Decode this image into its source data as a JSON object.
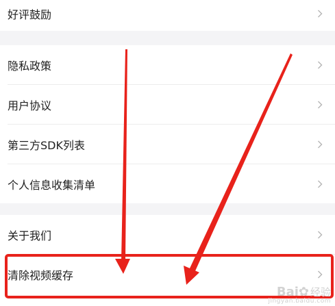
{
  "settings": {
    "items": [
      {
        "label": "好评鼓励"
      },
      {
        "label": "隐私政策"
      },
      {
        "label": "用户协议"
      },
      {
        "label": "第三方SDK列表"
      },
      {
        "label": "个人信息收集清单"
      },
      {
        "label": "关于我们"
      },
      {
        "label": "清除视频缓存"
      }
    ]
  },
  "annotation": {
    "arrow_color": "#e8221b",
    "highlight_color": "#e8221b"
  },
  "watermark": {
    "logo": "Bai",
    "logo_tail": "经验",
    "url": "jingyan.baidu.com"
  },
  "colors": {
    "background": "#f4f4f6",
    "row_background": "#ffffff",
    "text": "#1f1f1f",
    "chevron": "#b5b5b5",
    "divider": "#ececec"
  }
}
